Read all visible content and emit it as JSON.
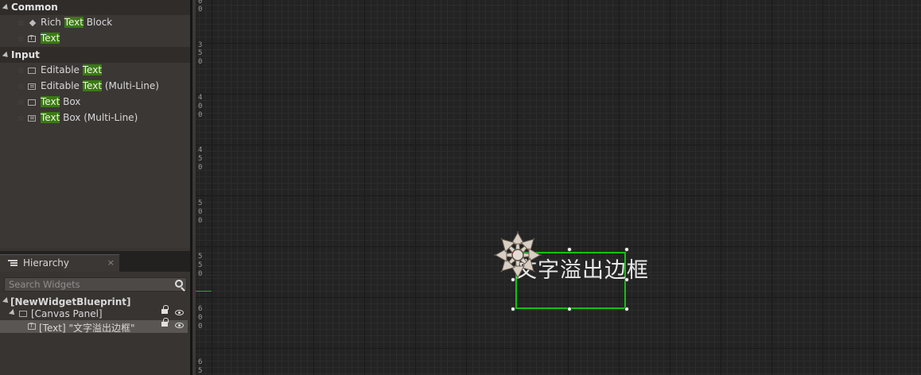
{
  "palette": {
    "categories": [
      {
        "name": "Common",
        "items": [
          {
            "pre": "Rich ",
            "match": "Text",
            "post": " Block",
            "icon": "diamond-icon"
          },
          {
            "pre": "",
            "match": "Text",
            "post": "",
            "icon": "text-block-icon"
          }
        ]
      },
      {
        "name": "Input",
        "items": [
          {
            "pre": "Editable ",
            "match": "Text",
            "post": "",
            "icon": "editable-text-icon"
          },
          {
            "pre": "Editable ",
            "match": "Text",
            "post": " (Multi-Line)",
            "icon": "editable-multiline-icon"
          },
          {
            "pre": "",
            "match": "Text",
            "post": " Box",
            "icon": "text-box-icon"
          },
          {
            "pre": "",
            "match": "Text",
            "post": " Box (Multi-Line)",
            "icon": "text-box-multiline-icon"
          }
        ]
      }
    ],
    "highlight_color": "#3a7a12"
  },
  "hierarchy": {
    "tab_label": "Hierarchy",
    "close_glyph": "×",
    "search_placeholder": "Search Widgets",
    "tree": [
      {
        "label": "[NewWidgetBlueprint]"
      },
      {
        "label": "[Canvas Panel]"
      },
      {
        "label": "[Text] \"文字溢出边框\""
      }
    ]
  },
  "ruler": {
    "ticks": [
      "0",
      "0",
      "3",
      "5",
      "0",
      "4",
      "0",
      "0",
      "4",
      "5",
      "0",
      "5",
      "0",
      "0",
      "5",
      "5",
      "0",
      "6",
      "0",
      "0",
      "6",
      "5"
    ]
  },
  "canvas": {
    "widget_text": "文字溢出边框",
    "selection_color": "#12c212"
  }
}
